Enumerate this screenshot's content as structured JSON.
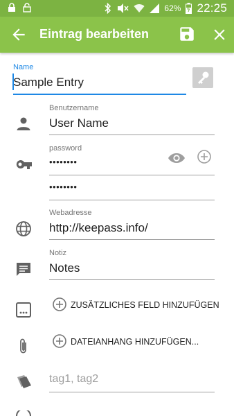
{
  "status_bar": {
    "battery": "62%",
    "time": "22:25"
  },
  "app_bar": {
    "title": "Eintrag bearbeiten"
  },
  "form": {
    "name": {
      "label": "Name",
      "value": "Sample Entry"
    },
    "username": {
      "label": "Benutzername",
      "value": "User Name"
    },
    "password": {
      "label": "password",
      "value": "••••••••",
      "confirm_value": "••••••••"
    },
    "url": {
      "label": "Webadresse",
      "value": "http://keepass.info/"
    },
    "notes": {
      "label": "Notiz",
      "value": "Notes"
    },
    "add_field_label": "ZUSÄTZLICHES FELD HINZUFÜGEN",
    "add_attachment_label": "DATEIANHANG HINZUFÜGEN...",
    "tags": {
      "placeholder": "tag1, tag2"
    }
  },
  "colors": {
    "primary": "#8bc34a",
    "primary_dark": "#7cb342",
    "accent": "#1e88e5"
  },
  "icons": [
    "lock-icon",
    "bluetooth-icon",
    "mute-icon",
    "wifi-icon",
    "signal-icon",
    "battery-icon",
    "back-arrow-icon",
    "save-icon",
    "close-icon",
    "key-icon",
    "person-icon",
    "vpn-key-icon",
    "eye-icon",
    "add-circle-icon",
    "globe-icon",
    "notes-icon",
    "extra-field-icon",
    "attachment-icon",
    "tag-icon"
  ]
}
